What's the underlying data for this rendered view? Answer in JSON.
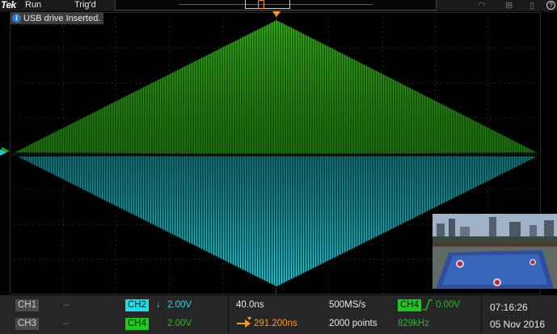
{
  "topbar": {
    "logo": "Tek",
    "run_state": "Run",
    "trigger_state": "Trig'd",
    "help": "?"
  },
  "notification": {
    "icon": "info-icon",
    "text": "USB drive Inserted."
  },
  "waveforms": {
    "ch4_color": "#2a9a14",
    "ch2_color": "#1ec8d0"
  },
  "channels": {
    "ch1": {
      "label": "CH1",
      "value": "--"
    },
    "ch3": {
      "label": "CH3",
      "value": "--"
    },
    "ch2": {
      "label": "CH2",
      "coupling_icon": "↓",
      "scale": "2.00V",
      "color": "#18e0e8"
    },
    "ch4": {
      "label": "CH4",
      "scale": "2.00V",
      "color": "#1ec81e"
    }
  },
  "horizontal": {
    "time_per_div": "40.0ns",
    "delay": "291.200ns",
    "sample_rate": "500MS/s",
    "record_length": "2000 points"
  },
  "trigger": {
    "source": "CH4",
    "slope_icon": "rising-edge-icon",
    "level": "0.00V",
    "frequency": "829kHz"
  },
  "clock": {
    "time": "07:16:26",
    "date": "05 Nov 2016"
  }
}
